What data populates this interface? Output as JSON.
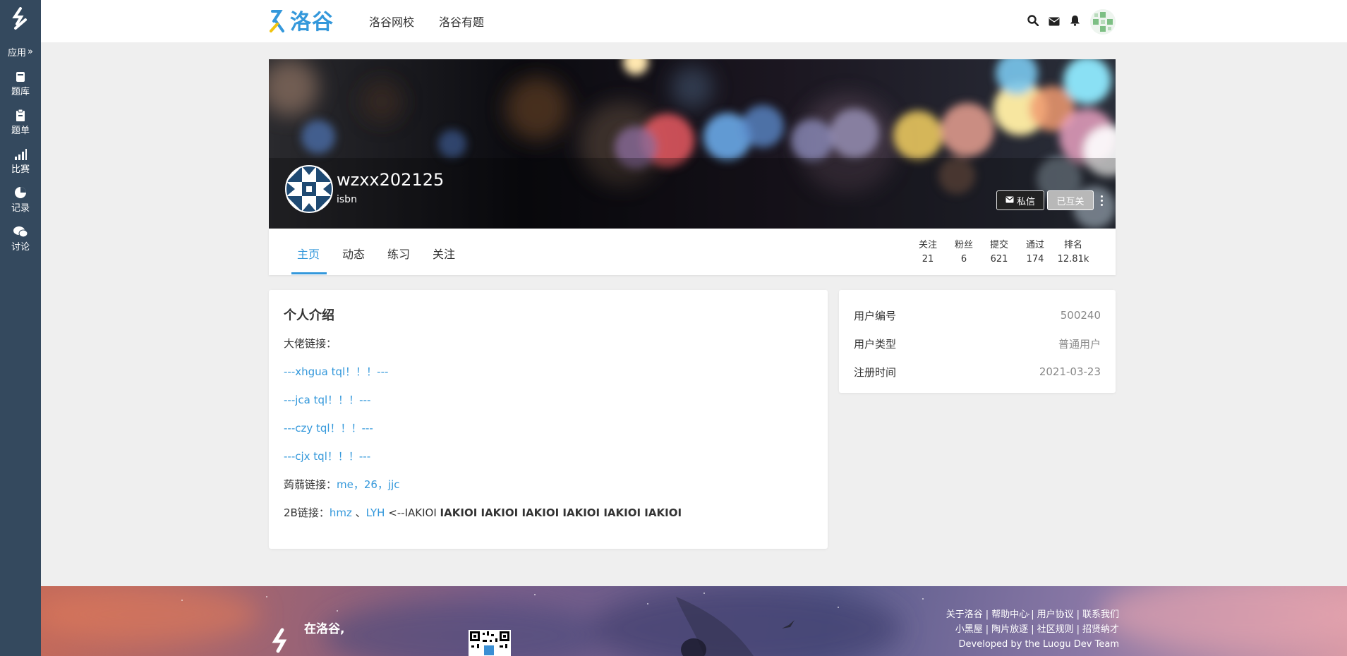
{
  "sidebar": {
    "apps_label": "应用",
    "items": [
      {
        "label": "题库",
        "icon": "book-icon"
      },
      {
        "label": "题单",
        "icon": "clipboard-icon"
      },
      {
        "label": "比赛",
        "icon": "bar-chart-icon"
      },
      {
        "label": "记录",
        "icon": "pie-chart-icon"
      },
      {
        "label": "讨论",
        "icon": "comments-icon"
      }
    ]
  },
  "header": {
    "brand": "洛谷",
    "nav": [
      "洛谷网校",
      "洛谷有题"
    ],
    "icons": [
      "search-icon",
      "envelope-icon",
      "bell-icon"
    ]
  },
  "profile": {
    "username": "wzxx202125",
    "tag": "isbn",
    "message_button": "私信",
    "follow_button": "已互关",
    "tabs": [
      "主页",
      "动态",
      "练习",
      "关注"
    ],
    "active_tab": "主页",
    "stats": [
      {
        "label": "关注",
        "value": "21"
      },
      {
        "label": "粉丝",
        "value": "6"
      },
      {
        "label": "提交",
        "value": "621"
      },
      {
        "label": "通过",
        "value": "174"
      },
      {
        "label": "排名",
        "value": "12.81k"
      }
    ]
  },
  "intro": {
    "title": "个人介绍",
    "line1": "大佬链接：",
    "link1": "---xhgua tql！！！---",
    "link2": "---jca tql！！！---",
    "link3": "---czy tql！！！---",
    "link4": "---cjx tql！！！---",
    "line6_prefix": "蒟蒻链接：",
    "line6_links": "me，26，jjc",
    "line7_prefix": "2B链接：",
    "line7_link_a": "hmz",
    "line7_sep": " 、",
    "line7_link_b": "LYH",
    "line7_plain": " <--IAKIOI ",
    "line7_bold": "IAKIOI IAKIOI IAKIOI IAKIOI IAKIOI IAKIOI"
  },
  "info": {
    "rows": [
      {
        "label": "用户编号",
        "value": "500240"
      },
      {
        "label": "用户类型",
        "value": "普通用户"
      },
      {
        "label": "注册时间",
        "value": "2021-03-23"
      }
    ]
  },
  "footer": {
    "links_row1": [
      "关于洛谷",
      "帮助中心",
      "用户协议",
      "联系我们"
    ],
    "links_row2": [
      "小黑屋",
      "陶片放逐",
      "社区规则",
      "招贤纳才"
    ],
    "dev_prefix": "Developed by the ",
    "dev_team": "Luogu Dev Team",
    "slogan_line1": "在洛谷,"
  },
  "colors": {
    "sidebar": "#34495e",
    "accent": "#3498db",
    "page_bg": "#efefef"
  }
}
